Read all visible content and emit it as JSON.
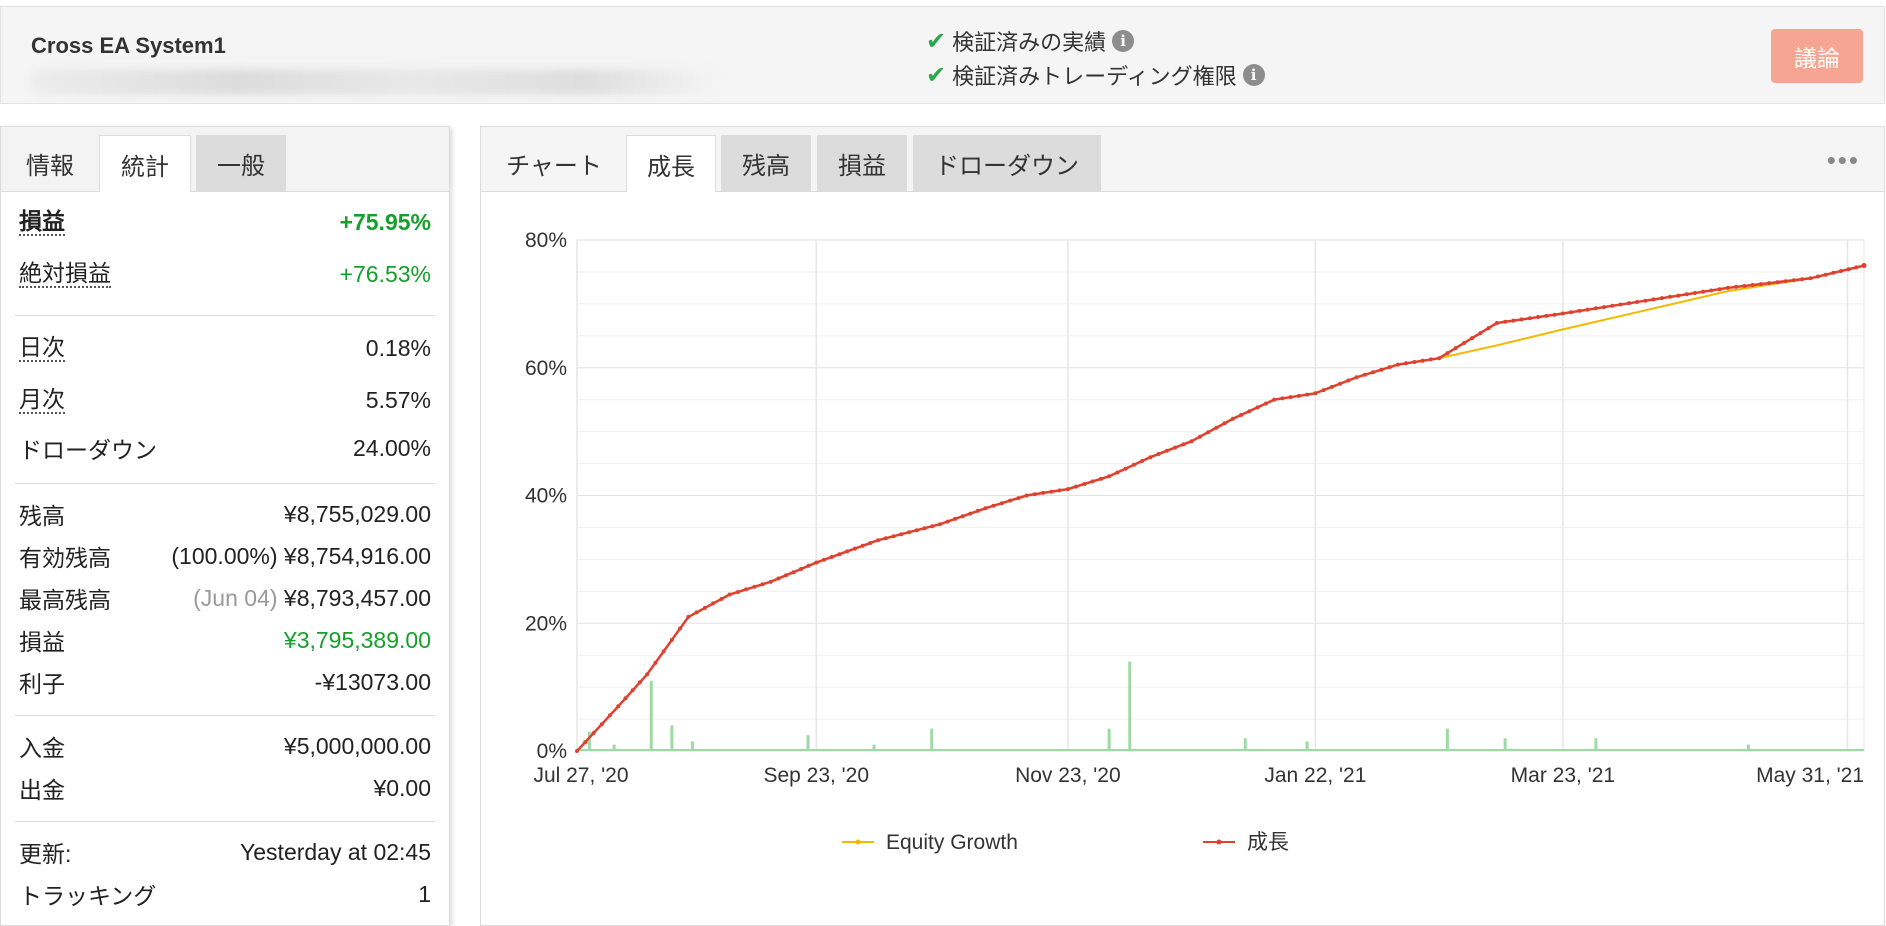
{
  "header": {
    "system_name": "Cross EA System1",
    "verified_track_record": "検証済みの実績",
    "verified_trading_privileges": "検証済みトレーディング権限",
    "discuss_button": "議論",
    "info_glyph": "i",
    "check_glyph": "✔"
  },
  "left_tabs": [
    "情報",
    "統計",
    "一般"
  ],
  "left_active_tab": "統計",
  "stats": {
    "gain": {
      "label": "損益",
      "value": "+75.95%"
    },
    "abs_gain": {
      "label": "絶対損益",
      "value": "+76.53%"
    },
    "daily": {
      "label": "日次",
      "value": "0.18%"
    },
    "monthly": {
      "label": "月次",
      "value": "5.57%"
    },
    "drawdown": {
      "label": "ドローダウン",
      "value": "24.00%"
    },
    "balance": {
      "label": "残高",
      "value": "¥8,755,029.00"
    },
    "equity": {
      "label": "有効残高",
      "pct": "(100.00%)",
      "value": "¥8,754,916.00"
    },
    "highest": {
      "label": "最高残高",
      "date": "(Jun 04)",
      "value": "¥8,793,457.00"
    },
    "profit": {
      "label": "損益",
      "value": "¥3,795,389.00"
    },
    "interest": {
      "label": "利子",
      "value": "-¥13073.00"
    },
    "deposits": {
      "label": "入金",
      "value": "¥5,000,000.00"
    },
    "withdrawals": {
      "label": "出金",
      "value": "¥0.00"
    },
    "updated": {
      "label": "更新:",
      "value": "Yesterday at 02:45"
    },
    "tracking": {
      "label": "トラッキング",
      "value": "1"
    }
  },
  "chart_tabs": [
    "チャート",
    "成長",
    "残高",
    "損益",
    "ドローダウン"
  ],
  "chart_active_tab": "成長",
  "menu_glyph": "•••",
  "colors": {
    "growth": "#e0412f",
    "equity": "#f5b800",
    "volume": "#9fd9a6",
    "positive": "#15a02a",
    "discuss_button": "#f5a591"
  },
  "chart_data": {
    "type": "line",
    "x_tick_labels": [
      "Jul 27, '20",
      "Sep 23, '20",
      "Nov 23, '20",
      "Jan 22, '21",
      "Mar 23, '21",
      "May 31, '21"
    ],
    "y_tick_labels": [
      "0%",
      "20%",
      "40%",
      "60%",
      "80%"
    ],
    "ylim": [
      0,
      80
    ],
    "xlim": [
      "2020-07-27",
      "2021-06-04"
    ],
    "grid": true,
    "legend_position": "bottom",
    "series": [
      {
        "name": "Equity Growth",
        "x": [
          "2020-07-27",
          "2020-08-06",
          "2020-08-13",
          "2020-08-23",
          "2020-09-02",
          "2020-09-12",
          "2020-09-23",
          "2020-10-08",
          "2020-10-23",
          "2020-11-03",
          "2020-11-13",
          "2020-11-23",
          "2020-12-03",
          "2020-12-13",
          "2020-12-23",
          "2021-01-02",
          "2021-01-12",
          "2021-01-22",
          "2021-02-01",
          "2021-02-11",
          "2021-02-21",
          "2021-03-07",
          "2021-03-23",
          "2021-04-12",
          "2021-05-02",
          "2021-05-22",
          "2021-06-04"
        ],
        "values": [
          0,
          7,
          12,
          21,
          24.5,
          26.5,
          29.5,
          33,
          35.5,
          38,
          40,
          41,
          43,
          46,
          48.5,
          52,
          55,
          56,
          58.5,
          60.5,
          61.5,
          63.5,
          66,
          69,
          72,
          74,
          76
        ]
      },
      {
        "name": "成長",
        "x": [
          "2020-07-27",
          "2020-08-06",
          "2020-08-13",
          "2020-08-23",
          "2020-09-02",
          "2020-09-12",
          "2020-09-23",
          "2020-10-08",
          "2020-10-23",
          "2020-11-03",
          "2020-11-13",
          "2020-11-23",
          "2020-12-03",
          "2020-12-13",
          "2020-12-23",
          "2021-01-02",
          "2021-01-12",
          "2021-01-22",
          "2021-02-01",
          "2021-02-11",
          "2021-02-21",
          "2021-03-07",
          "2021-03-23",
          "2021-04-12",
          "2021-05-02",
          "2021-05-22",
          "2021-06-04"
        ],
        "values": [
          0,
          7,
          12,
          21,
          24.5,
          26.5,
          29.5,
          33,
          35.5,
          38,
          40,
          41,
          43,
          46,
          48.5,
          52,
          55,
          56,
          58.5,
          60.5,
          61.5,
          67,
          68.5,
          70.5,
          72.5,
          74,
          76
        ]
      }
    ],
    "volume_bars": [
      {
        "x": "2020-07-30",
        "value": 3
      },
      {
        "x": "2020-08-05",
        "value": 1
      },
      {
        "x": "2020-08-14",
        "value": 11
      },
      {
        "x": "2020-08-19",
        "value": 4
      },
      {
        "x": "2020-08-24",
        "value": 1.5
      },
      {
        "x": "2020-09-21",
        "value": 2.5
      },
      {
        "x": "2020-10-07",
        "value": 1
      },
      {
        "x": "2020-10-21",
        "value": 3.5
      },
      {
        "x": "2020-12-03",
        "value": 3.5
      },
      {
        "x": "2020-12-08",
        "value": 14
      },
      {
        "x": "2021-01-05",
        "value": 2
      },
      {
        "x": "2021-01-20",
        "value": 1.5
      },
      {
        "x": "2021-02-23",
        "value": 3.5
      },
      {
        "x": "2021-03-09",
        "value": 2
      },
      {
        "x": "2021-03-31",
        "value": 2
      },
      {
        "x": "2021-05-07",
        "value": 1
      }
    ]
  }
}
